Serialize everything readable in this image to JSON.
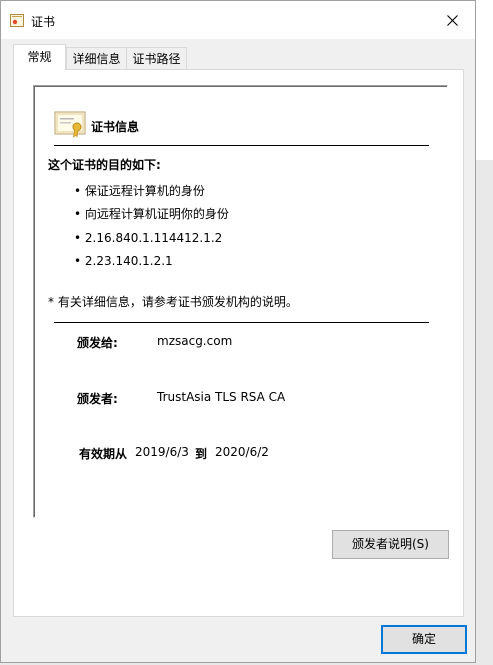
{
  "window": {
    "title": "证书"
  },
  "tabs": [
    {
      "label": "常规",
      "active": true
    },
    {
      "label": "详细信息",
      "active": false
    },
    {
      "label": "证书路径",
      "active": false
    }
  ],
  "cert_info": {
    "heading": "证书信息",
    "purpose_title": "这个证书的目的如下:",
    "purposes": [
      "保证远程计算机的身份",
      "向远程计算机证明你的身份",
      "2.16.840.1.114412.1.2",
      "2.23.140.1.2.1"
    ],
    "note": "* 有关详细信息，请参考证书颁发机构的说明。",
    "issued_to_label": "颁发给:",
    "issued_to": "mzsacg.com",
    "issued_by_label": "颁发者:",
    "issued_by": "TrustAsia TLS RSA CA",
    "valid_label": "有效期从",
    "valid_from": "2019/6/3",
    "to_label": "到",
    "valid_to": "2020/6/2"
  },
  "buttons": {
    "issuer_statement": "颁发者说明(S)",
    "ok": "确定"
  },
  "colors": {
    "accent": "#0078d7",
    "dialog_bg": "#f0f0f0"
  }
}
